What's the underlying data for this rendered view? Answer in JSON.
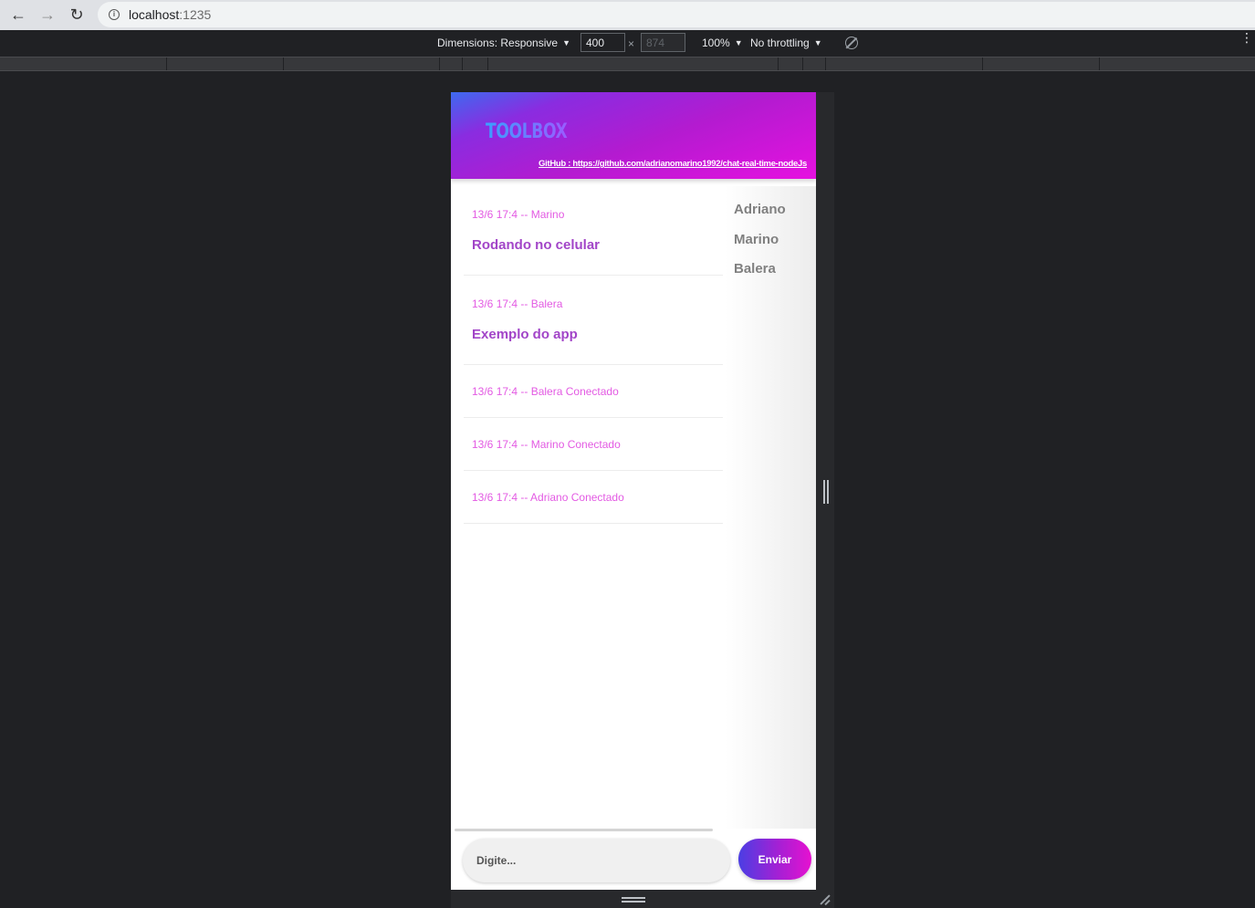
{
  "browser": {
    "url_host": "localhost",
    "url_port": ":1235"
  },
  "device_toolbar": {
    "dimensions_label": "Dimensions: Responsive",
    "width": "400",
    "height": "874",
    "zoom": "100%",
    "throttling": "No throttling"
  },
  "app": {
    "logo": "TOOLBOX",
    "github": "GitHub : https://github.com/adrianomarino1992/chat-real-time-nodeJs",
    "messages": [
      {
        "meta": "13/6 17:4 -- Marino",
        "text": "Rodando no celular"
      },
      {
        "meta": "13/6 17:4 -- Balera",
        "text": "Exemplo do app"
      },
      {
        "meta": "13/6 17:4 -- Balera Conectado"
      },
      {
        "meta": "13/6 17:4 -- Marino Conectado"
      },
      {
        "meta": "13/6 17:4 -- Adriano Conectado"
      }
    ],
    "users": [
      "Adriano",
      "Marino",
      "Balera"
    ],
    "input_placeholder": "Digite...",
    "send_label": "Enviar"
  }
}
